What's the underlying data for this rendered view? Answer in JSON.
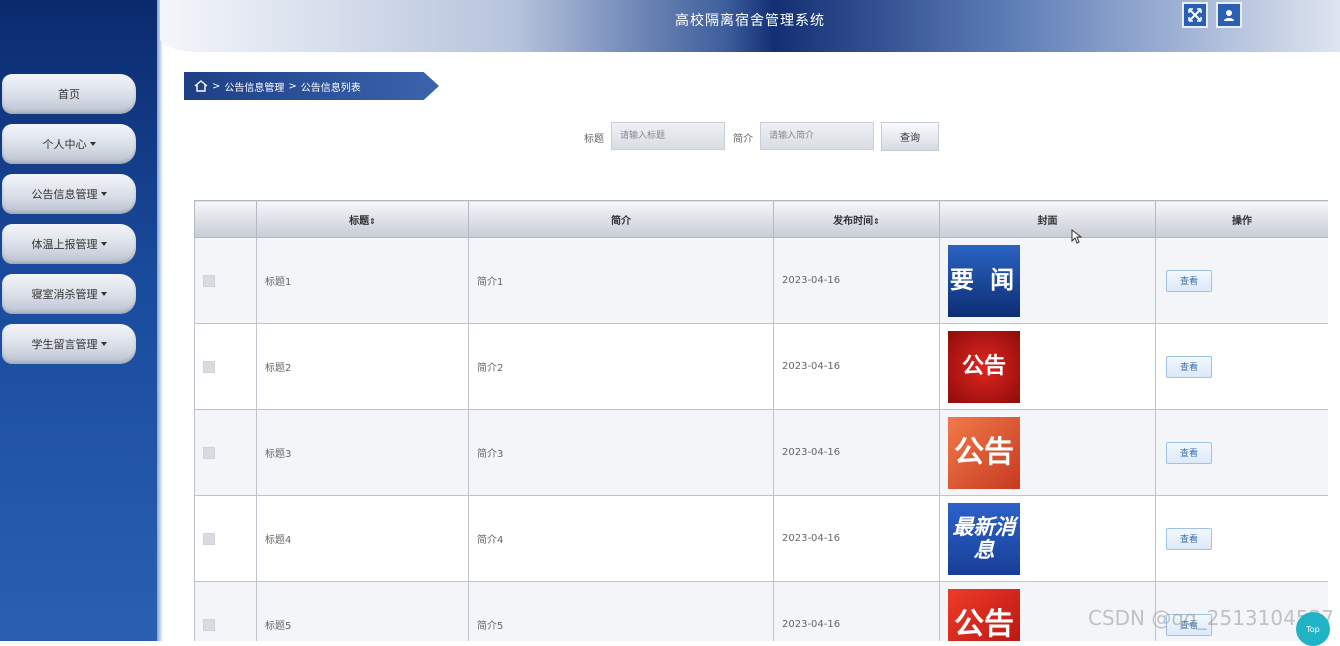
{
  "header": {
    "title": "高校隔离宿舍管理系统"
  },
  "sidebar": {
    "items": [
      {
        "label": "首页",
        "dropdown": false
      },
      {
        "label": "个人中心",
        "dropdown": true
      },
      {
        "label": "公告信息管理",
        "dropdown": true
      },
      {
        "label": "体温上报管理",
        "dropdown": true
      },
      {
        "label": "寝室消杀管理",
        "dropdown": true
      },
      {
        "label": "学生留言管理",
        "dropdown": true
      }
    ]
  },
  "breadcrumb": {
    "level1": "公告信息管理",
    "level2": "公告信息列表",
    "separator": ">"
  },
  "search": {
    "title_label": "标题",
    "title_placeholder": "请输入标题",
    "intro_label": "简介",
    "intro_placeholder": "请输入简介",
    "button": "查询"
  },
  "table": {
    "columns": {
      "title": "标题",
      "intro": "简介",
      "time": "发布时间",
      "cover": "封面",
      "action": "操作",
      "sort_mark": "⇕"
    },
    "rows": [
      {
        "title": "标题1",
        "intro": "简介1",
        "time": "2023-04-16",
        "cover_text": "要 闻",
        "cover_color": "#1c4fa8",
        "action": "查看"
      },
      {
        "title": "标题2",
        "intro": "简介2",
        "time": "2023-04-16",
        "cover_text": "公告",
        "cover_color": "#c2110f",
        "action": "查看"
      },
      {
        "title": "标题3",
        "intro": "简介3",
        "time": "2023-04-16",
        "cover_text": "公告",
        "cover_color": "#d9452a",
        "action": "查看"
      },
      {
        "title": "标题4",
        "intro": "简介4",
        "time": "2023-04-16",
        "cover_text": "最新消息",
        "cover_color": "#1e4fae",
        "action": "查看"
      },
      {
        "title": "标题5",
        "intro": "简介5",
        "time": "2023-04-16",
        "cover_text": "公告",
        "cover_color": "#cf1a12",
        "action": "查看"
      }
    ]
  },
  "watermark": "CSDN @qq_2513104537",
  "top_button": "Top"
}
